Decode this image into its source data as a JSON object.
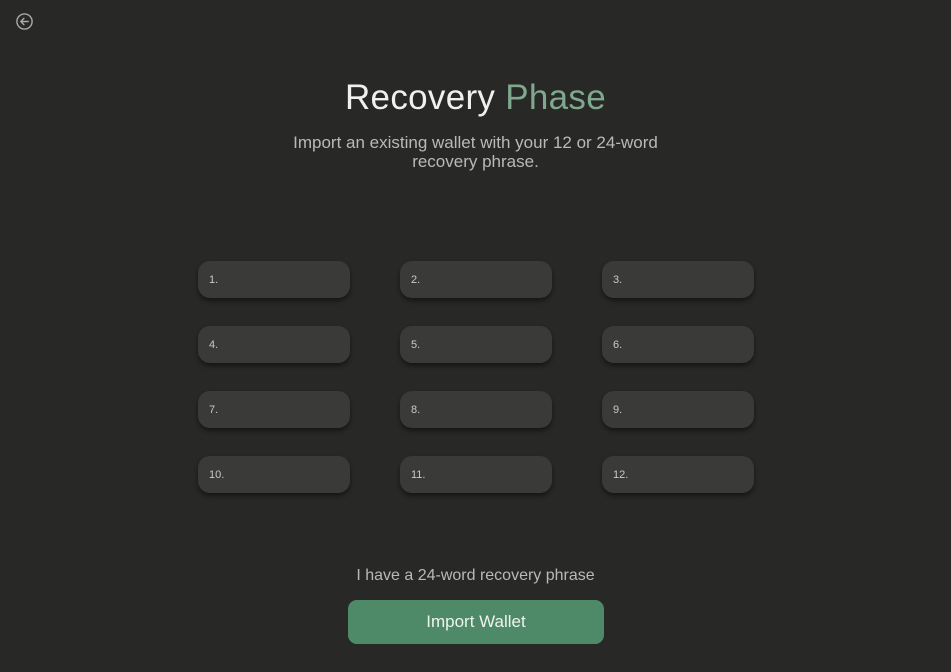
{
  "header": {
    "back_icon": "arrow-left-circle-icon",
    "title_primary": "Recovery",
    "title_accent": "Phase",
    "subtitle": "Import an existing wallet with your 12 or 24-word recovery phrase."
  },
  "word_slots": [
    {
      "label": "1."
    },
    {
      "label": "2."
    },
    {
      "label": "3."
    },
    {
      "label": "4."
    },
    {
      "label": "5."
    },
    {
      "label": "6."
    },
    {
      "label": "7."
    },
    {
      "label": "8."
    },
    {
      "label": "9."
    },
    {
      "label": "10."
    },
    {
      "label": "11."
    },
    {
      "label": "12."
    }
  ],
  "footer": {
    "toggle_text": "I have a 24-word recovery phrase",
    "import_button_label": "Import Wallet"
  },
  "colors": {
    "background": "#282827",
    "accent": "#7fa88e",
    "button": "#4f8a68",
    "slot": "#3a3a39"
  }
}
